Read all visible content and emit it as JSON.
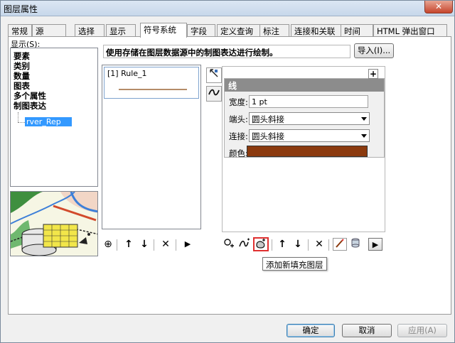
{
  "window": {
    "title": "图层属性",
    "close_glyph": "✕"
  },
  "tabs": [
    {
      "label": "常规"
    },
    {
      "label": "源"
    },
    {
      "label": "选择"
    },
    {
      "label": "显示"
    },
    {
      "label": "符号系统",
      "active": true
    },
    {
      "label": "字段"
    },
    {
      "label": "定义查询"
    },
    {
      "label": "标注"
    },
    {
      "label": "连接和关联"
    },
    {
      "label": "时间"
    },
    {
      "label": "HTML 弹出窗口"
    }
  ],
  "show_panel": {
    "label": "显示(S):",
    "items": [
      "要素",
      "类别",
      "数量",
      "图表",
      "多个属性",
      "制图表达"
    ],
    "sub_item": "rver_Rep"
  },
  "description": "使用存储在图层数据源中的制图表达进行绘制。",
  "import_button": "导入(I)...",
  "rules": [
    {
      "label": "[1] Rule_1",
      "line_color": "#b58c68"
    }
  ],
  "properties": {
    "header": "线",
    "width_label": "宽度:",
    "width_value": "1 pt",
    "cap_label": "端头:",
    "cap_value": "圆头斜接",
    "join_label": "连接:",
    "join_value": "圆头斜接",
    "color_label": "颜色:",
    "color_value": "#8b3a0e"
  },
  "rule_toolbar": {
    "add": "⊕",
    "up": "↑",
    "down": "↓",
    "delete": "✕",
    "more": "▶"
  },
  "layer_toolbar": {
    "up": "↑",
    "down": "↓",
    "delete": "✕",
    "more": "▶"
  },
  "tooltip": "添加新填充图层",
  "footer": {
    "ok": "确定",
    "cancel": "取消",
    "apply": "应用(A)"
  },
  "colors": {
    "accent": "#3399ff",
    "highlight": "#e03030"
  }
}
